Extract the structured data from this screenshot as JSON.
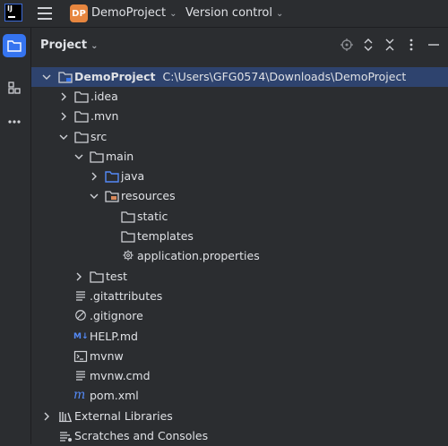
{
  "app": {
    "logo_text": "IJ"
  },
  "titlebar": {
    "project_badge": "DP",
    "project_name": "DemoProject",
    "version_control": "Version control"
  },
  "panel": {
    "title": "Project"
  },
  "tree": [
    {
      "label": "DemoProject",
      "path": "C:\\Users\\GFG0574\\Downloads\\DemoProject",
      "icon": "module-folder-icon",
      "expanded": true,
      "selected": true
    },
    {
      "label": ".idea",
      "icon": "folder-icon",
      "expanded": false
    },
    {
      "label": ".mvn",
      "icon": "folder-icon",
      "expanded": false
    },
    {
      "label": "src",
      "icon": "folder-icon",
      "expanded": true
    },
    {
      "label": "main",
      "icon": "folder-icon",
      "expanded": true
    },
    {
      "label": "java",
      "icon": "source-folder-icon",
      "expanded": false
    },
    {
      "label": "resources",
      "icon": "resources-folder-icon",
      "expanded": true
    },
    {
      "label": "static",
      "icon": "folder-icon"
    },
    {
      "label": "templates",
      "icon": "folder-icon"
    },
    {
      "label": "application.properties",
      "icon": "properties-gear-icon"
    },
    {
      "label": "test",
      "icon": "folder-icon",
      "expanded": false
    },
    {
      "label": ".gitattributes",
      "icon": "text-file-icon"
    },
    {
      "label": ".gitignore",
      "icon": "gitignore-icon"
    },
    {
      "label": "HELP.md",
      "icon": "markdown-icon"
    },
    {
      "label": "mvnw",
      "icon": "terminal-file-icon"
    },
    {
      "label": "mvnw.cmd",
      "icon": "text-file-icon"
    },
    {
      "label": "pom.xml",
      "icon": "maven-icon"
    },
    {
      "label": "External Libraries",
      "icon": "libraries-icon",
      "expanded": false
    },
    {
      "label": "Scratches and Consoles",
      "icon": "scratches-icon"
    }
  ],
  "colors": {
    "background": "#2b2d30",
    "selection": "#2e436e",
    "accent": "#3574f0",
    "project_badge": "#e7863f"
  }
}
